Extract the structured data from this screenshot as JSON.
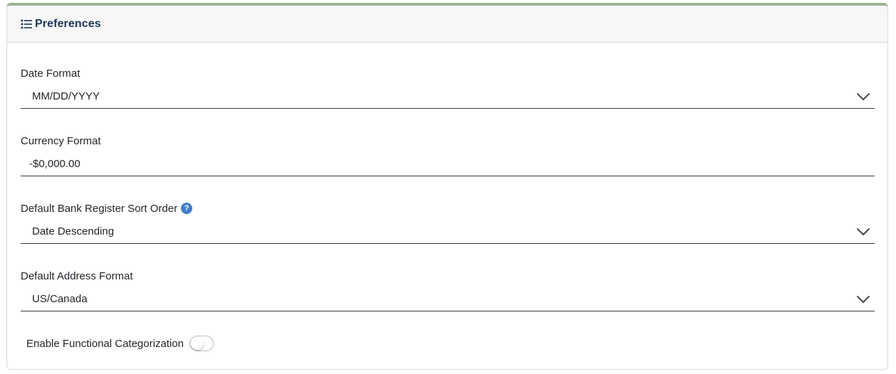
{
  "header": {
    "title": "Preferences",
    "icon": "list-icon"
  },
  "fields": {
    "date_format": {
      "label": "Date Format",
      "value": "MM/DD/YYYY"
    },
    "currency_format": {
      "label": "Currency Format",
      "value": "-$0,000.00"
    },
    "sort_order": {
      "label": "Default Bank Register Sort Order",
      "help": "?",
      "value": "Date Descending"
    },
    "address_format": {
      "label": "Default Address Format",
      "value": "US/Canada"
    }
  },
  "functional_categorization": {
    "label": "Enable Functional Categorization",
    "enabled": false
  },
  "colors": {
    "accent_border": "#9db48e",
    "header_text": "#1d3557",
    "help_icon": "#3f7fc8"
  }
}
